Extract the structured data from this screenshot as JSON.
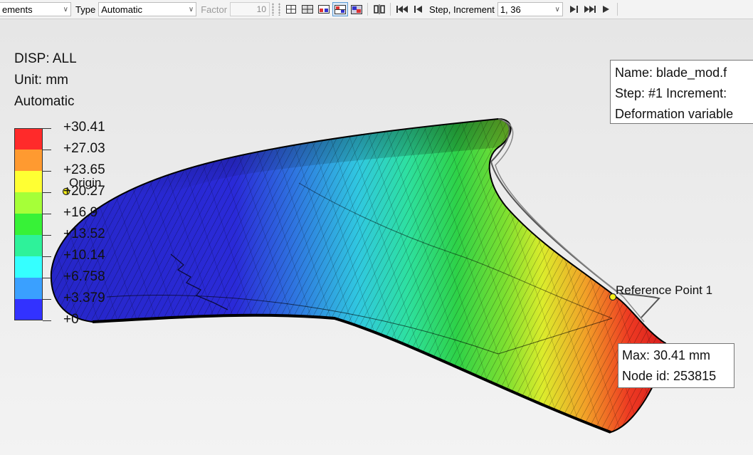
{
  "toolbar": {
    "left_select_value": "ements",
    "type_label": "Type",
    "type_value": "Automatic",
    "factor_label": "Factor",
    "factor_value": "10",
    "step_label": "Step, Increment",
    "step_value": "1, 36"
  },
  "viewport": {
    "variable_line": "DISP: ALL",
    "unit_line": "Unit: mm",
    "mode_line": "Automatic",
    "legend": {
      "labels": [
        "+30.41",
        "+27.03",
        "+23.65",
        "+20.27",
        "+16.9",
        "+13.52",
        "+10.14",
        "+6.758",
        "+3.379",
        "+0"
      ],
      "colors": [
        "#ff2a2a",
        "#ff9a30",
        "#ffff33",
        "#a6ff38",
        "#37f237",
        "#2ef29a",
        "#35ffff",
        "#3aa0ff",
        "#3232ff"
      ]
    },
    "info_box": {
      "name_line": "Name: blade_mod.f",
      "step_line": "Step: #1   Increment:",
      "deformation_line": "Deformation variable"
    },
    "origin_label": "Origin",
    "ref_point_label": "Reference Point 1",
    "tooltip": {
      "max_line": "Max: 30.41 mm",
      "node_line": "Node id: 253815"
    }
  }
}
